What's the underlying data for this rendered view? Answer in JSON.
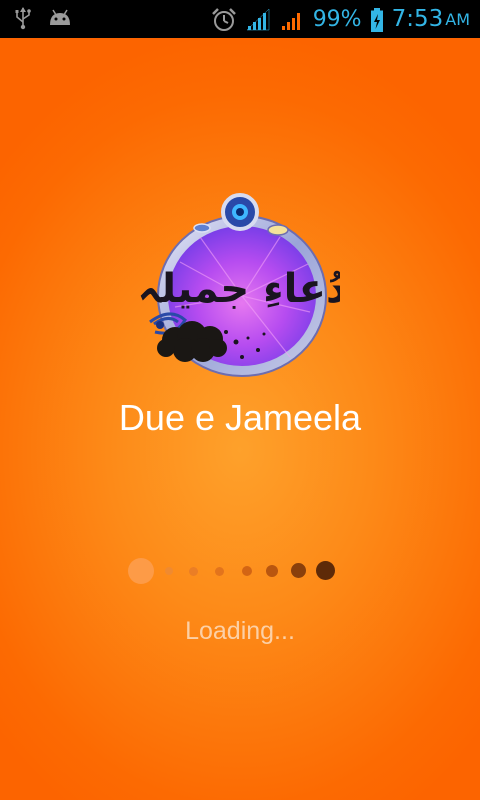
{
  "status_bar": {
    "battery_percent": "99%",
    "time": "7:53",
    "ampm": "AM",
    "icons": [
      "usb-icon",
      "android-debug-icon",
      "alarm-clock-icon",
      "wifi-signal-icon",
      "cell-signal-icon",
      "battery-charging-icon"
    ],
    "accent_color": "#33b5e5",
    "background_color": "#000000"
  },
  "splash": {
    "background_color": "#fc6a02",
    "logo_text": "دُعاءِ جمیلہ",
    "app_title": "Due e Jameela",
    "loading_text": "Loading..."
  }
}
